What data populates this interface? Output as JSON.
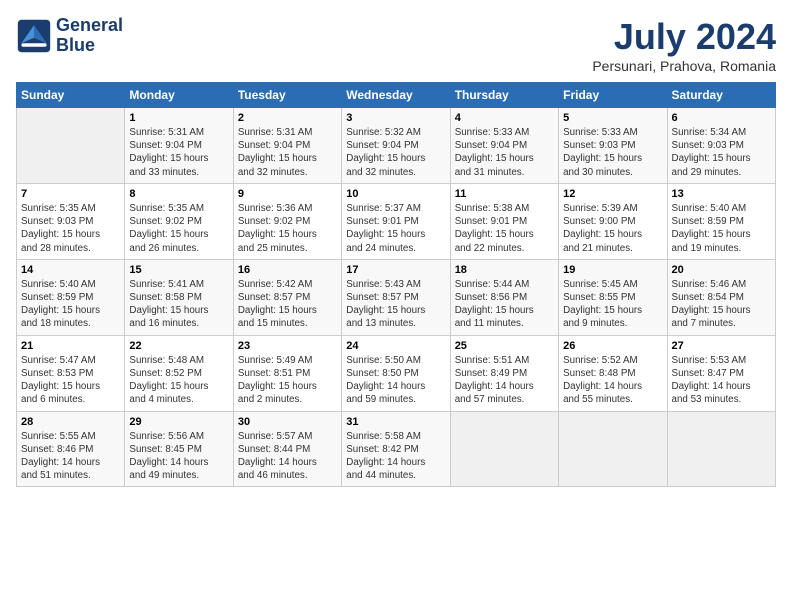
{
  "logo": {
    "line1": "General",
    "line2": "Blue"
  },
  "title": "July 2024",
  "subtitle": "Persunari, Prahova, Romania",
  "headers": [
    "Sunday",
    "Monday",
    "Tuesday",
    "Wednesday",
    "Thursday",
    "Friday",
    "Saturday"
  ],
  "weeks": [
    [
      {
        "num": "",
        "info": ""
      },
      {
        "num": "1",
        "info": "Sunrise: 5:31 AM\nSunset: 9:04 PM\nDaylight: 15 hours\nand 33 minutes."
      },
      {
        "num": "2",
        "info": "Sunrise: 5:31 AM\nSunset: 9:04 PM\nDaylight: 15 hours\nand 32 minutes."
      },
      {
        "num": "3",
        "info": "Sunrise: 5:32 AM\nSunset: 9:04 PM\nDaylight: 15 hours\nand 32 minutes."
      },
      {
        "num": "4",
        "info": "Sunrise: 5:33 AM\nSunset: 9:04 PM\nDaylight: 15 hours\nand 31 minutes."
      },
      {
        "num": "5",
        "info": "Sunrise: 5:33 AM\nSunset: 9:03 PM\nDaylight: 15 hours\nand 30 minutes."
      },
      {
        "num": "6",
        "info": "Sunrise: 5:34 AM\nSunset: 9:03 PM\nDaylight: 15 hours\nand 29 minutes."
      }
    ],
    [
      {
        "num": "7",
        "info": "Sunrise: 5:35 AM\nSunset: 9:03 PM\nDaylight: 15 hours\nand 28 minutes."
      },
      {
        "num": "8",
        "info": "Sunrise: 5:35 AM\nSunset: 9:02 PM\nDaylight: 15 hours\nand 26 minutes."
      },
      {
        "num": "9",
        "info": "Sunrise: 5:36 AM\nSunset: 9:02 PM\nDaylight: 15 hours\nand 25 minutes."
      },
      {
        "num": "10",
        "info": "Sunrise: 5:37 AM\nSunset: 9:01 PM\nDaylight: 15 hours\nand 24 minutes."
      },
      {
        "num": "11",
        "info": "Sunrise: 5:38 AM\nSunset: 9:01 PM\nDaylight: 15 hours\nand 22 minutes."
      },
      {
        "num": "12",
        "info": "Sunrise: 5:39 AM\nSunset: 9:00 PM\nDaylight: 15 hours\nand 21 minutes."
      },
      {
        "num": "13",
        "info": "Sunrise: 5:40 AM\nSunset: 8:59 PM\nDaylight: 15 hours\nand 19 minutes."
      }
    ],
    [
      {
        "num": "14",
        "info": "Sunrise: 5:40 AM\nSunset: 8:59 PM\nDaylight: 15 hours\nand 18 minutes."
      },
      {
        "num": "15",
        "info": "Sunrise: 5:41 AM\nSunset: 8:58 PM\nDaylight: 15 hours\nand 16 minutes."
      },
      {
        "num": "16",
        "info": "Sunrise: 5:42 AM\nSunset: 8:57 PM\nDaylight: 15 hours\nand 15 minutes."
      },
      {
        "num": "17",
        "info": "Sunrise: 5:43 AM\nSunset: 8:57 PM\nDaylight: 15 hours\nand 13 minutes."
      },
      {
        "num": "18",
        "info": "Sunrise: 5:44 AM\nSunset: 8:56 PM\nDaylight: 15 hours\nand 11 minutes."
      },
      {
        "num": "19",
        "info": "Sunrise: 5:45 AM\nSunset: 8:55 PM\nDaylight: 15 hours\nand 9 minutes."
      },
      {
        "num": "20",
        "info": "Sunrise: 5:46 AM\nSunset: 8:54 PM\nDaylight: 15 hours\nand 7 minutes."
      }
    ],
    [
      {
        "num": "21",
        "info": "Sunrise: 5:47 AM\nSunset: 8:53 PM\nDaylight: 15 hours\nand 6 minutes."
      },
      {
        "num": "22",
        "info": "Sunrise: 5:48 AM\nSunset: 8:52 PM\nDaylight: 15 hours\nand 4 minutes."
      },
      {
        "num": "23",
        "info": "Sunrise: 5:49 AM\nSunset: 8:51 PM\nDaylight: 15 hours\nand 2 minutes."
      },
      {
        "num": "24",
        "info": "Sunrise: 5:50 AM\nSunset: 8:50 PM\nDaylight: 14 hours\nand 59 minutes."
      },
      {
        "num": "25",
        "info": "Sunrise: 5:51 AM\nSunset: 8:49 PM\nDaylight: 14 hours\nand 57 minutes."
      },
      {
        "num": "26",
        "info": "Sunrise: 5:52 AM\nSunset: 8:48 PM\nDaylight: 14 hours\nand 55 minutes."
      },
      {
        "num": "27",
        "info": "Sunrise: 5:53 AM\nSunset: 8:47 PM\nDaylight: 14 hours\nand 53 minutes."
      }
    ],
    [
      {
        "num": "28",
        "info": "Sunrise: 5:55 AM\nSunset: 8:46 PM\nDaylight: 14 hours\nand 51 minutes."
      },
      {
        "num": "29",
        "info": "Sunrise: 5:56 AM\nSunset: 8:45 PM\nDaylight: 14 hours\nand 49 minutes."
      },
      {
        "num": "30",
        "info": "Sunrise: 5:57 AM\nSunset: 8:44 PM\nDaylight: 14 hours\nand 46 minutes."
      },
      {
        "num": "31",
        "info": "Sunrise: 5:58 AM\nSunset: 8:42 PM\nDaylight: 14 hours\nand 44 minutes."
      },
      {
        "num": "",
        "info": ""
      },
      {
        "num": "",
        "info": ""
      },
      {
        "num": "",
        "info": ""
      }
    ]
  ]
}
